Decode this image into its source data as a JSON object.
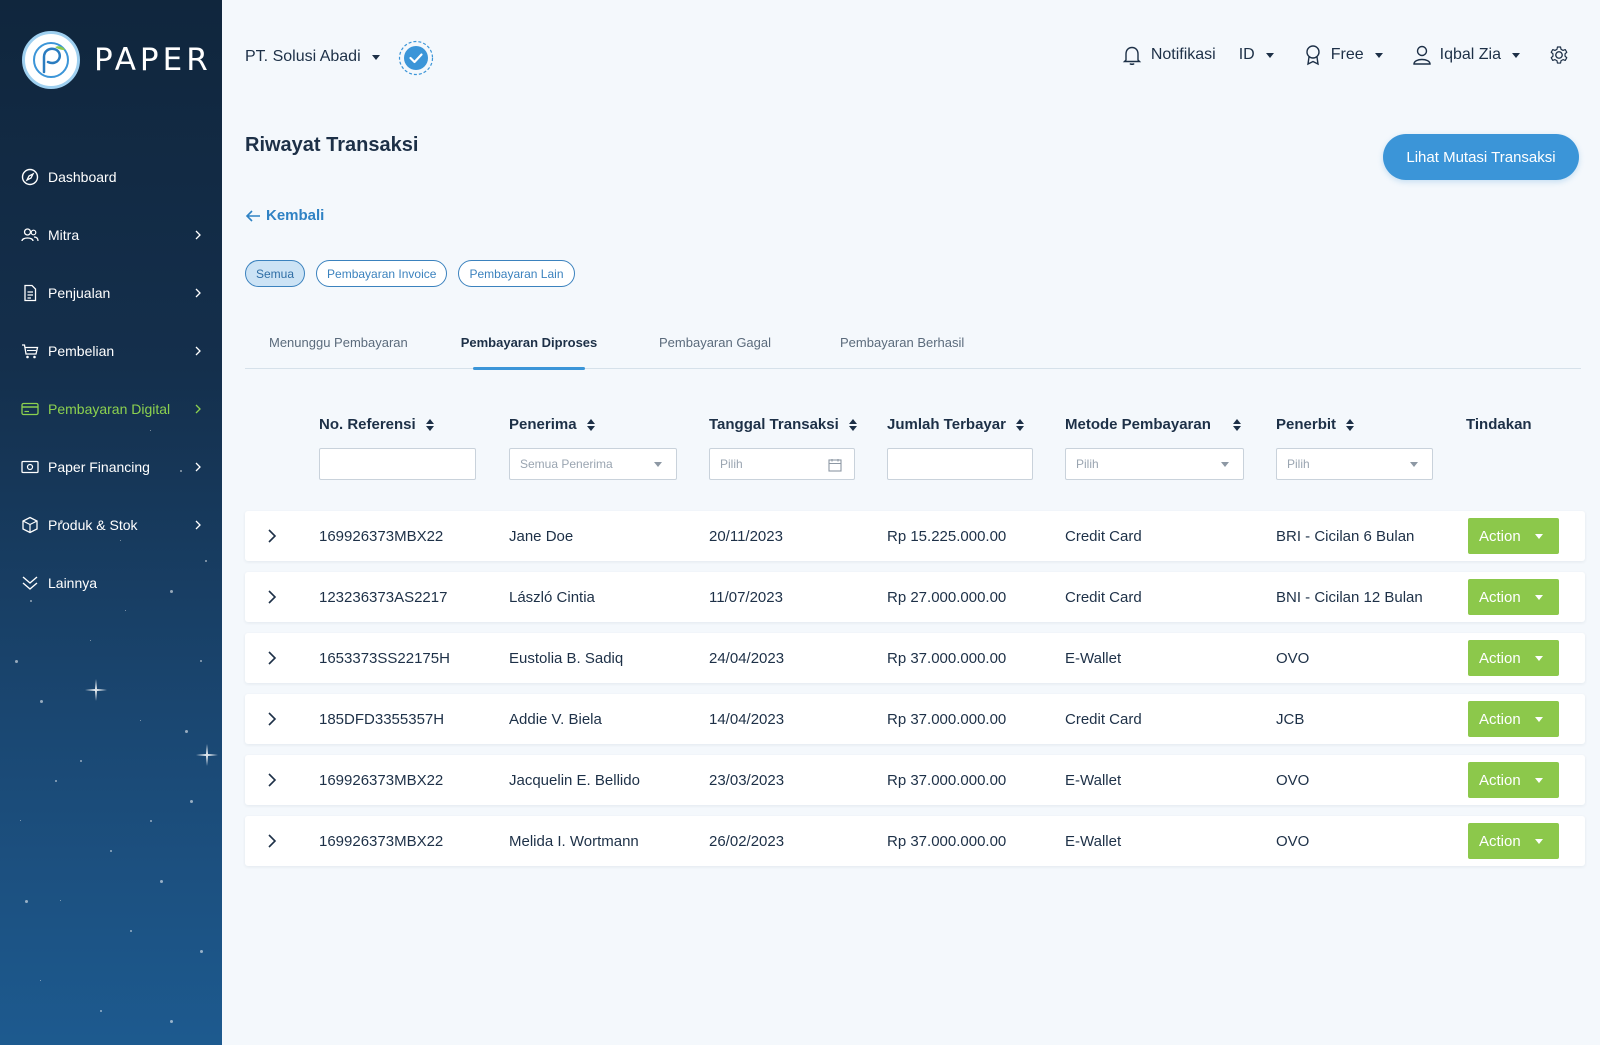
{
  "brand": {
    "name": "PAPER"
  },
  "sidebar": {
    "items": [
      {
        "label": "Dashboard",
        "icon": "compass-icon",
        "has_chevron": false
      },
      {
        "label": "Mitra",
        "icon": "users-icon",
        "has_chevron": true
      },
      {
        "label": "Penjualan",
        "icon": "document-icon",
        "has_chevron": true
      },
      {
        "label": "Pembelian",
        "icon": "cart-icon",
        "has_chevron": true
      },
      {
        "label": "Pembayaran Digital",
        "icon": "card-icon",
        "has_chevron": true,
        "active": true
      },
      {
        "label": "Paper Financing",
        "icon": "money-icon",
        "has_chevron": true
      },
      {
        "label": "Produk & Stok",
        "icon": "box-icon",
        "has_chevron": true
      },
      {
        "label": "Lainnya",
        "icon": "more-icon",
        "has_chevron": false
      }
    ]
  },
  "header": {
    "company": "PT. Solusi Abadi",
    "notifications_label": "Notifikasi",
    "language": "ID",
    "plan": "Free",
    "user": "Iqbal Zia"
  },
  "page": {
    "title": "Riwayat Transaksi",
    "primary_button": "Lihat Mutasi Transaksi",
    "back_label": "Kembali"
  },
  "chips": [
    {
      "label": "Semua",
      "active": true
    },
    {
      "label": "Pembayaran Invoice",
      "active": false
    },
    {
      "label": "Pembayaran Lain",
      "active": false
    }
  ],
  "tabs": [
    {
      "label": "Menunggu Pembayaran",
      "active": false
    },
    {
      "label": "Pembayaran Diproses",
      "active": true
    },
    {
      "label": "Pembayaran Gagal",
      "active": false
    },
    {
      "label": "Pembayaran Berhasil",
      "active": false
    }
  ],
  "table": {
    "columns": {
      "ref": "No. Referensi",
      "recipient": "Penerima",
      "date": "Tanggal Transaksi",
      "amount": "Jumlah Terbayar",
      "method": "Metode Pembayaran",
      "issuer": "Penerbit",
      "action": "Tindakan"
    },
    "filters": {
      "recipient_placeholder": "Semua Penerima",
      "date_placeholder": "Pilih",
      "method_placeholder": "Pilih",
      "issuer_placeholder": "Pilih"
    },
    "action_label": "Action",
    "rows": [
      {
        "ref": "169926373MBX22",
        "recipient": "Jane Doe",
        "date": "20/11/2023",
        "amount": "Rp 15.225.000.00",
        "method": "Credit Card",
        "issuer": "BRI - Cicilan 6 Bulan"
      },
      {
        "ref": "123236373AS2217",
        "recipient": "László Cintia",
        "date": "11/07/2023",
        "amount": "Rp 27.000.000.00",
        "method": "Credit Card",
        "issuer": "BNI - Cicilan 12 Bulan"
      },
      {
        "ref": "1653373SS22175H",
        "recipient": "Eustolia B. Sadiq",
        "date": "24/04/2023",
        "amount": "Rp 37.000.000.00",
        "method": "E-Wallet",
        "issuer": "OVO"
      },
      {
        "ref": "185DFD3355357H",
        "recipient": "Addie V. Biela",
        "date": "14/04/2023",
        "amount": "Rp 37.000.000.00",
        "method": "Credit Card",
        "issuer": "JCB"
      },
      {
        "ref": "169926373MBX22",
        "recipient": "Jacquelin E. Bellido",
        "date": "23/03/2023",
        "amount": "Rp 37.000.000.00",
        "method": "E-Wallet",
        "issuer": "OVO"
      },
      {
        "ref": "169926373MBX22",
        "recipient": "Melida I. Wortmann",
        "date": "26/02/2023",
        "amount": "Rp 37.000.000.00",
        "method": "E-Wallet",
        "issuer": "OVO"
      }
    ]
  },
  "colors": {
    "accent": "#3b95d8",
    "success": "#8cc84b",
    "sidebar_active": "#8cd14f"
  }
}
